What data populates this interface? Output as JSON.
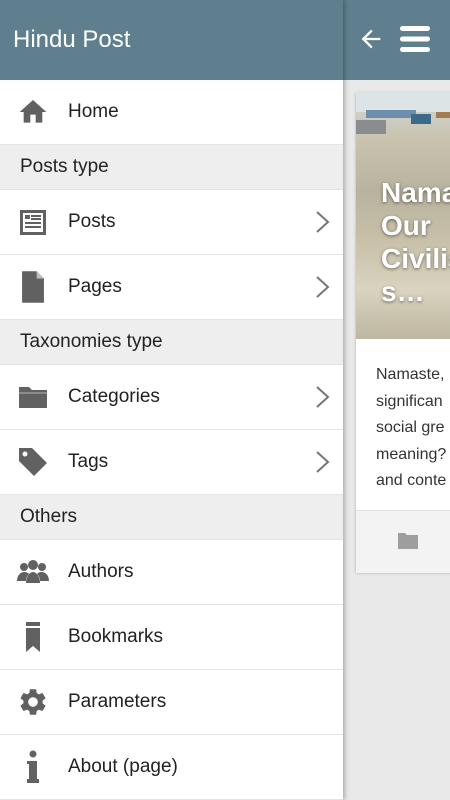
{
  "app": {
    "title": "Hindu Post"
  },
  "drawer": {
    "home": "Home",
    "section_posts_type": "Posts type",
    "posts": "Posts",
    "pages": "Pages",
    "section_taxonomies_type": "Taxonomies type",
    "categories": "Categories",
    "tags": "Tags",
    "section_others": "Others",
    "authors": "Authors",
    "bookmarks": "Bookmarks",
    "parameters": "Parameters",
    "about": "About (page)"
  },
  "card": {
    "title": "Nama\nOur\nCivilis\ns…",
    "excerpt": "Namaste,\nsignifican\nsocial gre\nmeaning?\nand conte"
  },
  "colors": {
    "appbar": "#5f7f8e",
    "icon": "#616161"
  },
  "icons": [
    "home-icon",
    "posts-icon",
    "pages-icon",
    "folder-icon",
    "tag-icon",
    "people-icon",
    "bookmark-icon",
    "gear-icon",
    "info-icon",
    "back-arrow-icon",
    "menu-icon",
    "chevron-right-icon"
  ]
}
